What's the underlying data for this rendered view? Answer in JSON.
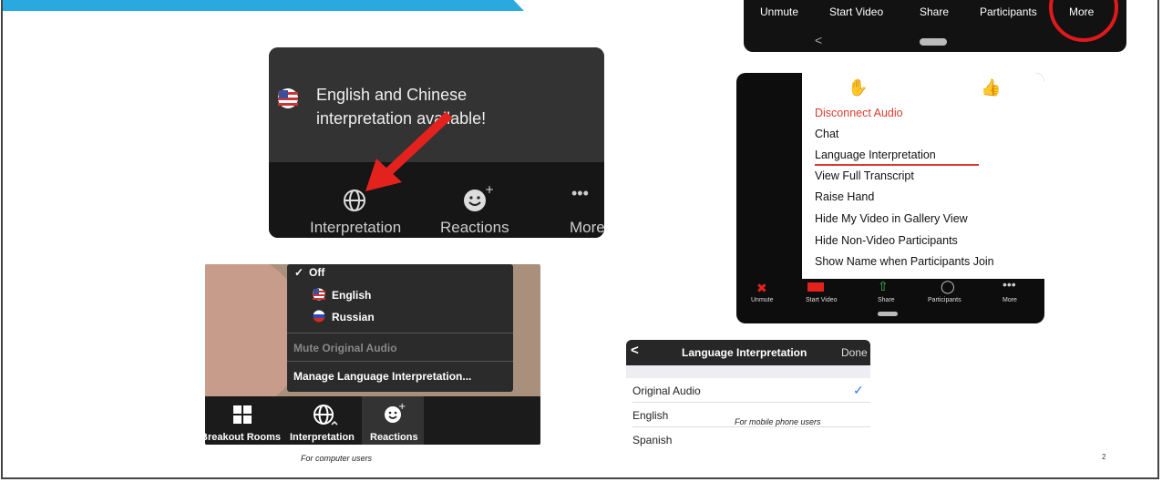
{
  "top_mobile_bar": {
    "items": [
      "Unmute",
      "Start Video",
      "Share",
      "Participants",
      "More"
    ],
    "back": "<"
  },
  "popup": {
    "message_line1": "English and Chinese",
    "message_line2": "interpretation available!",
    "toolbar": [
      "Interpretation",
      "Reactions",
      "More"
    ]
  },
  "more_menu": {
    "items": [
      "Disconnect Audio",
      "Chat",
      "Language Interpretation",
      "View Full Transcript",
      "Raise Hand",
      "Hide My Video in Gallery View",
      "Hide Non-Video Participants",
      "Show Name when Participants Join"
    ],
    "bottom_bar": [
      "Unmute",
      "Start Video",
      "Share",
      "Participants",
      "More"
    ],
    "accent_color": "#d93b2f"
  },
  "computer_menu": {
    "off": "Off",
    "english": "English",
    "russian": "Russian",
    "mute": "Mute Original Audio",
    "manage": "Manage Language Interpretation...",
    "toolbar": [
      "Breakout Rooms",
      "Interpretation",
      "Reactions"
    ]
  },
  "mobile_panel": {
    "back": "<",
    "title": "Language Interpretation",
    "done": "Done",
    "options": [
      "Original Audio",
      "English",
      "Spanish"
    ],
    "checked": "✓"
  },
  "captions": {
    "computer": "For computer users",
    "mobile": "For mobile phone users",
    "page_number": "2"
  }
}
